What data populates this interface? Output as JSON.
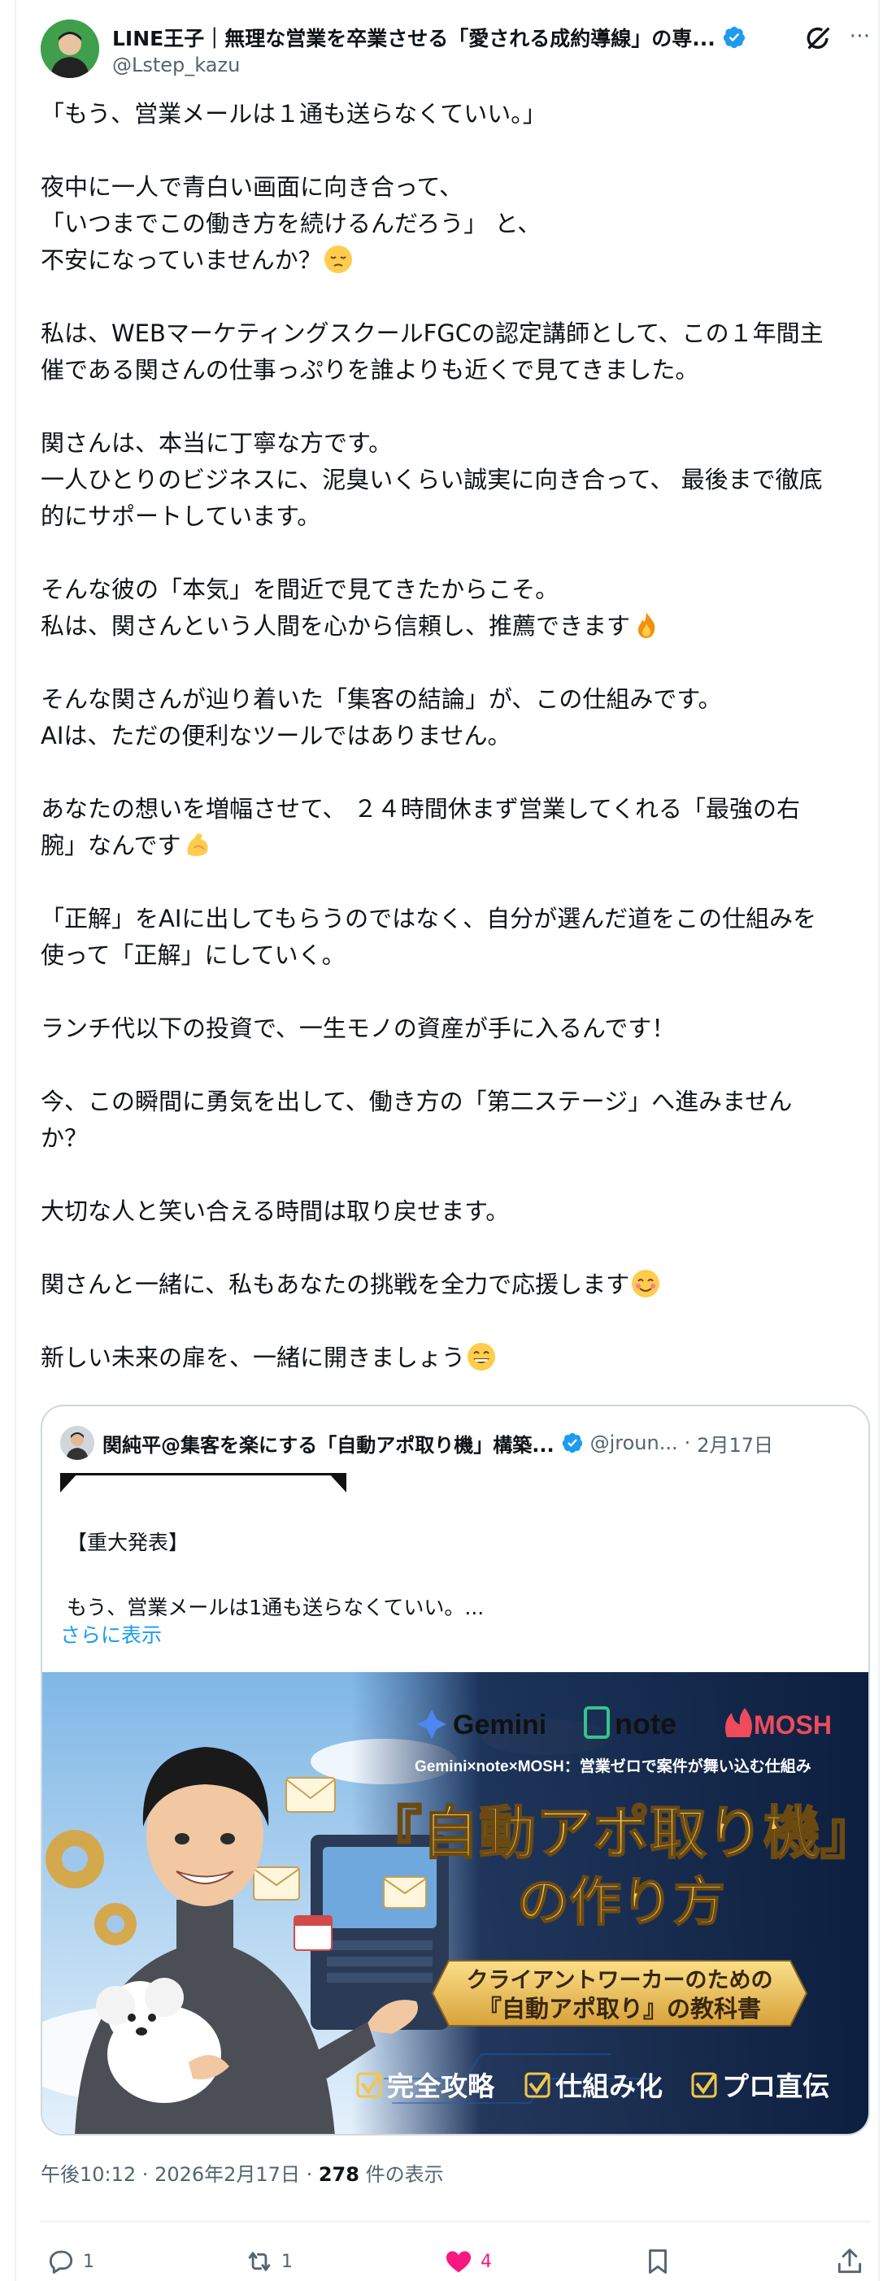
{
  "post": {
    "display_name": "LINE王子｜無理な営業を卒業させる「愛される成約導線」の専...",
    "handle": "@Lstep_kazu",
    "paragraphs": [
      [
        "「もう、営業メールは１通も送らなくていい。」"
      ],
      [
        "夜中に一人で青白い画面に向き合って、",
        "「いつまでこの働き方を続けるんだろう」 と、",
        "不安になっていませんか？"
      ],
      [
        "私は、WEBマーケティングスクールFGCの認定講師として、この１年間主",
        "催である関さんの仕事っぷりを誰よりも近くで見てきました。"
      ],
      [
        "関さんは、本当に丁寧な方です。",
        "一人ひとりのビジネスに、泥臭いくらい誠実に向き合って、 最後まで徹底",
        "的にサポートしています。"
      ],
      [
        "そんな彼の「本気」を間近で見てきたからこそ。",
        "私は、関さんという人間を心から信頼し、推薦できます"
      ],
      [
        "そんな関さんが辿り着いた「集客の結論」が、この仕組みです。",
        "AIは、ただの便利なツールではありません。"
      ],
      [
        "あなたの想いを増幅させて、 ２４時間休まず営業してくれる「最強の右",
        "腕」なんです"
      ],
      [
        "「正解」をAIに出してもらうのではなく、自分が選んだ道をこの仕組みを",
        "使って「正解」にしていく。"
      ],
      [
        "ランチ代以下の投資で、一生モノの資産が手に入るんです！"
      ],
      [
        " 今、この瞬間に勇気を出して、働き方の「第二ステージ」へ進みません",
        "か？"
      ],
      [
        "大切な人と笑い合える時間は取り戻せます。"
      ],
      [
        "関さんと一緒に、私もあなたの挑戦を全力で応援します"
      ],
      [
        "新しい未来の扉を、一緒に開きましょう"
      ]
    ],
    "emojis": {
      "pensive": "pensive-face-icon",
      "fire": "fire-icon",
      "muscle": "flexed-biceps-icon",
      "smile": "smiling-face-icon",
      "grin": "grinning-face-icon"
    }
  },
  "quoted_post": {
    "display_name": "関純平@集客を楽にする「自動アポ取り機」構築...",
    "handle": "@jroun...",
    "dot": "·",
    "date": "2月17日",
    "text_line1": "【重大発表】",
    "text_line2": "もう、営業メールは1通も送らなくていい。...",
    "show_more": "さらに表示",
    "image": {
      "logo_gemini": "Gemini",
      "logo_note": "note",
      "logo_mosh": "MOSH",
      "subtitle": "Gemini×note×MOSH：営業ゼロで案件が舞い込む仕組み",
      "title_line1": "『自動アポ取り機』",
      "title_line2": "の作り方",
      "ribbon_line1": "クライアントワーカーのための",
      "ribbon_line2": "『自動アポ取り』の教科書",
      "check1": "完全攻略",
      "check2": "仕組み化",
      "check3": "プロ直伝"
    }
  },
  "meta": {
    "time": "午後10:12",
    "separator": " · ",
    "date": "2026年2月17日",
    "views_count": "278",
    "views_label": " 件の表示"
  },
  "actions": {
    "reply_count": "1",
    "repost_count": "1",
    "like_count": "4"
  },
  "colors": {
    "accent_blue": "#1d9bf0",
    "like_pink": "#f91880",
    "text_secondary": "#536471",
    "text_primary": "#0f1419",
    "border": "#cfd9de"
  }
}
